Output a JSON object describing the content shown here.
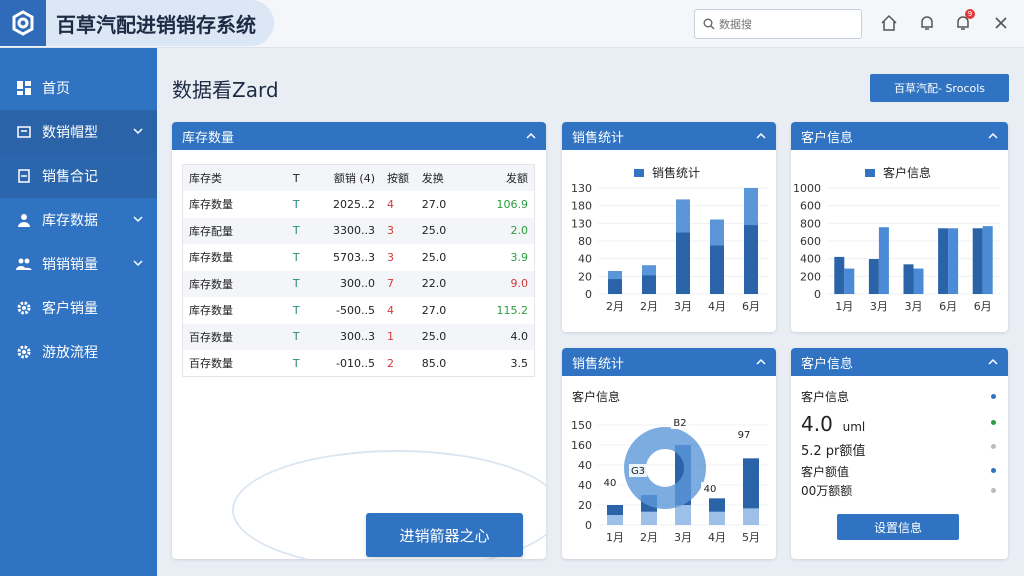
{
  "app": {
    "title": "百草汽配进销销存系统"
  },
  "search": {
    "placeholder": "数据搜"
  },
  "topbar": {
    "notif_count": "9"
  },
  "sidebar": {
    "items": [
      {
        "label": "首页"
      },
      {
        "label": "数销帽型"
      },
      {
        "label": "销售合记"
      },
      {
        "label": "库存数据"
      },
      {
        "label": "销销销量"
      },
      {
        "label": "客户销量"
      },
      {
        "label": "游放流程"
      }
    ]
  },
  "main": {
    "title": "数据看Zard",
    "top_button": "百草汽配- Srocols"
  },
  "inventory": {
    "title": "库存数量",
    "headers": [
      "库存类",
      "T",
      "额销 (4)",
      "按额",
      "发换",
      "发额"
    ],
    "rows": [
      [
        "库存数量",
        "T",
        "2025..2",
        "4",
        "27.0",
        "106.9"
      ],
      [
        "库存配量",
        "T",
        "3300..3",
        "3",
        "25.0",
        "2.0"
      ],
      [
        "库存数量",
        "T",
        "5703..3",
        "3",
        "25.0",
        "3.9"
      ],
      [
        "库存数量",
        "T",
        "300..0",
        "7",
        "22.0",
        "9.0"
      ],
      [
        "库存数量",
        "T",
        "-500..5",
        "4",
        "27.0",
        "115.2"
      ],
      [
        "百存数量",
        "T",
        "300..3",
        "1",
        "25.0",
        "4.0"
      ],
      [
        "百存数量",
        "T",
        "-010..5",
        "2",
        "85.0",
        "3.5"
      ]
    ],
    "center_button": "进销箭器之心"
  },
  "sales_top": {
    "title": "销售统计",
    "legend": "销售统计"
  },
  "customer_top": {
    "title": "客户信息",
    "legend": "客户信息"
  },
  "sales_bottom": {
    "title": "销售统计",
    "subtitle": "客户信息",
    "labels": [
      "B2",
      "G3",
      "40",
      "40",
      "97"
    ]
  },
  "customer_bottom": {
    "title": "客户信息",
    "line1": "客户信息",
    "big_value": "4.0",
    "big_unit": "uml",
    "line3": "5.2 pr额值",
    "line4": "客户额值",
    "line5": "00万额额",
    "button": "设置信息"
  },
  "colors": {
    "accent": "#2f73c2",
    "accent_light": "#5b97d8",
    "green": "#2a9d3c",
    "red": "#d23a3a",
    "sidebar": "#2f73c2"
  },
  "chart_data": [
    {
      "type": "bar",
      "title": "销售统计",
      "categories": [
        "2月",
        "2月",
        "3月",
        "4月",
        "6月"
      ],
      "series": [
        {
          "name": "销售统计",
          "values": [
            40,
            50,
            165,
            130,
            185
          ]
        }
      ],
      "ylim": [
        0,
        150
      ],
      "yticks": [
        "0",
        "20",
        "40",
        "80",
        "130",
        "180",
        "130"
      ]
    },
    {
      "type": "bar",
      "title": "客户信息",
      "categories": [
        "1月",
        "3月",
        "3月",
        "6月",
        "6月"
      ],
      "series": [
        {
          "name": "客户信息",
          "values": [
            350,
            330,
            280,
            620,
            620
          ]
        },
        {
          "values": [
            240,
            630,
            240,
            620,
            640
          ]
        }
      ],
      "ylim": [
        0,
        1000
      ],
      "yticks": [
        "0",
        "200",
        "400",
        "600",
        "800",
        "600",
        "1000"
      ]
    },
    {
      "type": "bar",
      "title": "销售统计",
      "categories": [
        "1月",
        "2月",
        "3月",
        "4月",
        "5月"
      ],
      "series": [
        {
          "values": [
            30,
            45,
            120,
            40,
            100
          ]
        },
        {
          "values": [
            15,
            20,
            30,
            20,
            25
          ]
        }
      ],
      "ylim": [
        0,
        150
      ],
      "yticks": [
        "0",
        "20",
        "40",
        "40",
        "160",
        "150"
      ]
    }
  ]
}
